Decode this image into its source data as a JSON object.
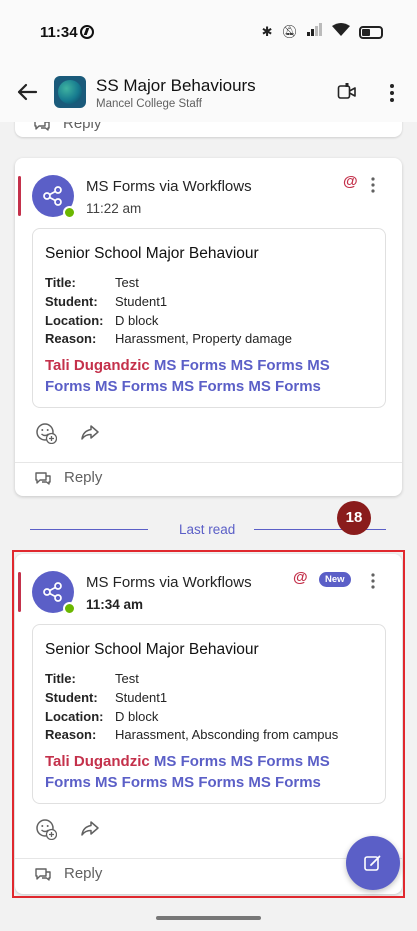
{
  "status_bar": {
    "time": "11:34"
  },
  "header": {
    "title": "SS Major Behaviours",
    "subtitle": "Mancel College Staff"
  },
  "previous_card": {
    "reply_label": "Reply"
  },
  "messages": [
    {
      "sender": "MS Forms via Workflows",
      "time": "11:22 am",
      "card_title": "Senior School Major Behaviour",
      "facts": [
        {
          "label": "Title:",
          "value": "Test"
        },
        {
          "label": "Student:",
          "value": "Student1"
        },
        {
          "label": "Location:",
          "value": "D block"
        },
        {
          "label": "Reason:",
          "value": "Harassment, Property damage"
        }
      ],
      "mention_person": "Tali Dugandzic",
      "mention_forms": "MS Forms MS Forms MS Forms MS Forms MS Forms MS Forms",
      "reply_label": "Reply"
    },
    {
      "sender": "MS Forms via Workflows",
      "time": "11:34 am",
      "badge": "New",
      "card_title": "Senior School Major Behaviour",
      "facts": [
        {
          "label": "Title:",
          "value": "Test"
        },
        {
          "label": "Student:",
          "value": "Student1"
        },
        {
          "label": "Location:",
          "value": "D block"
        },
        {
          "label": "Reason:",
          "value": "Harassment, Absconding from campus"
        }
      ],
      "mention_person": "Tali Dugandzic",
      "mention_forms": "MS Forms MS Forms MS Forms MS Forms MS Forms MS Forms",
      "reply_label": "Reply"
    }
  ],
  "last_read": {
    "label": "Last read",
    "unread_count": "18"
  },
  "icons": {
    "back": "arrow-left-icon",
    "video": "video-call-icon",
    "more": "more-vertical-icon",
    "bot": "share-nodes-icon",
    "mention": "at-mention-icon",
    "reaction": "add-reaction-icon",
    "share": "share-forward-icon",
    "reply": "reply-bubble-icon",
    "compose": "compose-icon"
  },
  "colors": {
    "accent": "#5b5fc7",
    "mention": "#c4314b",
    "unread_badge": "#8a1c1c",
    "highlight": "#e0282e"
  }
}
